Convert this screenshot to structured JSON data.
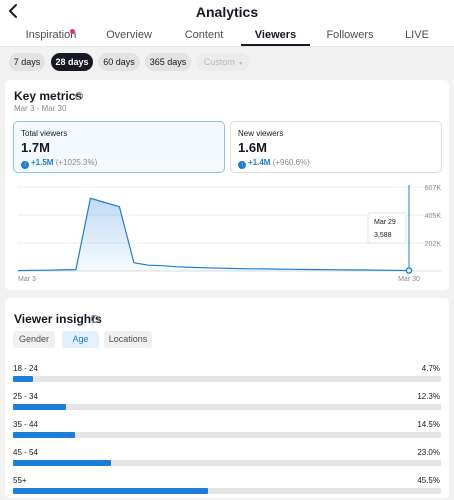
{
  "header": {
    "title": "Analytics",
    "back_icon": "chevron-left-icon"
  },
  "tabs": [
    {
      "label": "Inspiration",
      "active": false,
      "dot": true
    },
    {
      "label": "Overview",
      "active": false
    },
    {
      "label": "Content",
      "active": false
    },
    {
      "label": "Viewers",
      "active": true
    },
    {
      "label": "Followers",
      "active": false
    },
    {
      "label": "LIVE",
      "active": false
    }
  ],
  "ranges": [
    {
      "label": "7 days",
      "state": "normal"
    },
    {
      "label": "28 days",
      "state": "active"
    },
    {
      "label": "60 days",
      "state": "normal"
    },
    {
      "label": "365 days",
      "state": "normal"
    },
    {
      "label": "Custom",
      "state": "disabled"
    }
  ],
  "key_metrics": {
    "title": "Key metrics",
    "date_range": "Mar 3 - Mar 30",
    "cards": [
      {
        "label": "Total viewers",
        "value": "1.7M",
        "increase": "+1.5M",
        "pct": "(+1025.3%)",
        "selected": true
      },
      {
        "label": "New viewers",
        "value": "1.6M",
        "increase": "+1.4M",
        "pct": "(+960.6%)",
        "selected": false
      }
    ]
  },
  "chart_data": {
    "type": "area",
    "x_labels": [
      "Mar 3",
      "Mar 30"
    ],
    "y_ticks": [
      "607K",
      "405K",
      "202K"
    ],
    "ylim": [
      0,
      607000
    ],
    "values": [
      3000,
      5000,
      6000,
      8000,
      10000,
      525000,
      495000,
      465000,
      60000,
      42000,
      38000,
      30000,
      26000,
      23000,
      20000,
      18000,
      16000,
      15000,
      14000,
      12000,
      11000,
      10000,
      9000,
      8000,
      7000,
      6000,
      5000,
      3588
    ],
    "tooltip": {
      "date": "Mar 29",
      "value": "3,588"
    },
    "color": "#1c7ed6"
  },
  "viewer_insights": {
    "title": "Viewer insights",
    "segments": [
      {
        "label": "Gender",
        "active": false
      },
      {
        "label": "Age",
        "active": true
      },
      {
        "label": "Locations",
        "active": false
      }
    ],
    "rows": [
      {
        "label": "18 - 24",
        "value": "4.7%",
        "pct": 4.7
      },
      {
        "label": "25 - 34",
        "value": "12.3%",
        "pct": 12.3
      },
      {
        "label": "35 - 44",
        "value": "14.5%",
        "pct": 14.5
      },
      {
        "label": "45 - 54",
        "value": "23.0%",
        "pct": 23.0
      },
      {
        "label": "55+",
        "value": "45.5%",
        "pct": 45.5
      }
    ]
  }
}
